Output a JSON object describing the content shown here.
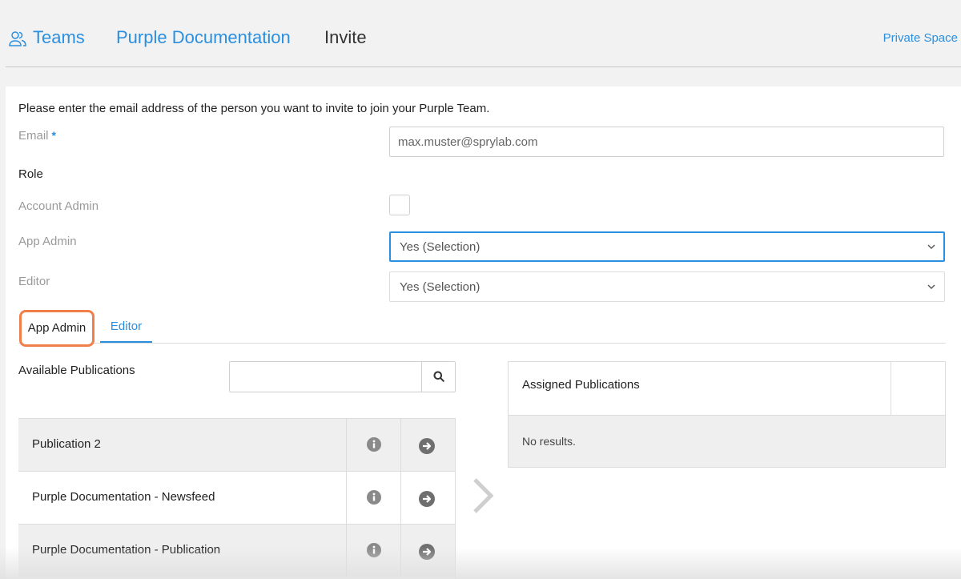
{
  "header": {
    "breadcrumb": [
      "Teams",
      "Purple Documentation",
      "Invite"
    ],
    "private_space": "Private Space"
  },
  "form": {
    "intro": "Please enter the email address of the person you want to invite to join your Purple Team.",
    "email_label": "Email",
    "email_required": "*",
    "email_value": "max.muster@sprylab.com",
    "role_heading": "Role",
    "account_admin_label": "Account Admin",
    "account_admin_checked": false,
    "app_admin_label": "App Admin",
    "app_admin_value": "Yes (Selection)",
    "editor_label": "Editor",
    "editor_value": "Yes (Selection)"
  },
  "tabs": [
    {
      "label": "App Admin",
      "highlighted": true
    },
    {
      "label": "Editor",
      "active": true
    }
  ],
  "available": {
    "title": "Available Publications",
    "search_value": "",
    "items": [
      "Publication 2",
      "Purple Documentation - Newsfeed",
      "Purple Documentation - Publication"
    ]
  },
  "assigned": {
    "title": "Assigned Publications",
    "empty_text": "No results."
  },
  "colors": {
    "accent": "#2b8fe0",
    "highlight": "#f07f4a"
  }
}
